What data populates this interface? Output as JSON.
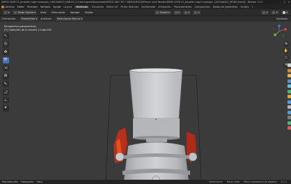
{
  "titlebar": {
    "title": "[MEDV 2036 15_bmodler Logo+Lasergun_CASCAANCO] \\MB-03 [C:\\Users\\geekl\\Downloads\\MODO ADO 3D Y VIDEOJUEGOS\\Primer nivle Render\\MEDV 2036 15_bmodler Logo+Lasergun_CASCAANCO_MODO.blend] - Blender 3.2.1",
    "controls": [
      "–",
      "□",
      "✕"
    ]
  },
  "menubar": {
    "app_menu": [
      "Archivo",
      "Editar",
      "Procesar",
      "Ventana",
      "Ayuda"
    ],
    "workspaces": [
      "Layout",
      "Modelado",
      "Esculpido",
      "Editar UV",
      "Pintar texturas",
      "Sombreado",
      "Animación",
      "Procesamiento",
      "Composición",
      "Nodos de geometría",
      "Scripts",
      "+"
    ],
    "active_workspace": "Modelado"
  },
  "header": {
    "mode": "Modo Objeto",
    "view": "Vista",
    "select": "Seleccionar",
    "add": "Agregar",
    "object": "Objeto",
    "transform": "Global",
    "icons": [
      "cursor-icon",
      "grid-icon",
      "magnet-icon",
      "proportional-icon"
    ]
  },
  "options_bar": {
    "orientation": "Orientación:",
    "default": "Predefinido",
    "drag": "Arrastrar:",
    "select_box": "Seleccionar Marcar",
    "options": "Opciones"
  },
  "viewport": {
    "view_label": "Perspectiva (perspectiva)",
    "collection_label": "(1) Colección de la escena | Cubo.001",
    "body_color": "#c4c6c9",
    "selected_color": "#f0711c",
    "background": "#3b3b3b"
  },
  "toolbar": {
    "tools": [
      "↖",
      "◎",
      "✥",
      "⟳",
      "⇲",
      "⊞",
      "✎",
      "◿",
      "⊥",
      "✦"
    ],
    "active_index": 3
  },
  "navigation": [
    "⊕",
    "✋",
    "🎥",
    "⊞"
  ],
  "gizmo": {
    "x_color": "#e0484f",
    "y_color": "#7fbd31",
    "z_color": "#3e7ae3",
    "labels": [
      "X",
      "Y",
      "Z"
    ]
  },
  "right_tabs": [
    "#d0d0d0",
    "#d28a2a",
    "#e4b54a",
    "#5c8ddd",
    "#5ac0e0",
    "#46b873",
    "#e0a73a",
    "#d74d6c",
    "#b3b3b3",
    "#4f9ddf",
    "#7e7e7e",
    "#cfcfcf",
    "#dd5b5b"
  ],
  "timeline": {
    "items": [
      "Reproducción",
      "Fotograma",
      "Vista"
    ],
    "hints": [
      "Seleccionar",
      "Rotar vista",
      "Menú contextual de objetos"
    ],
    "version": "3.2.1"
  }
}
